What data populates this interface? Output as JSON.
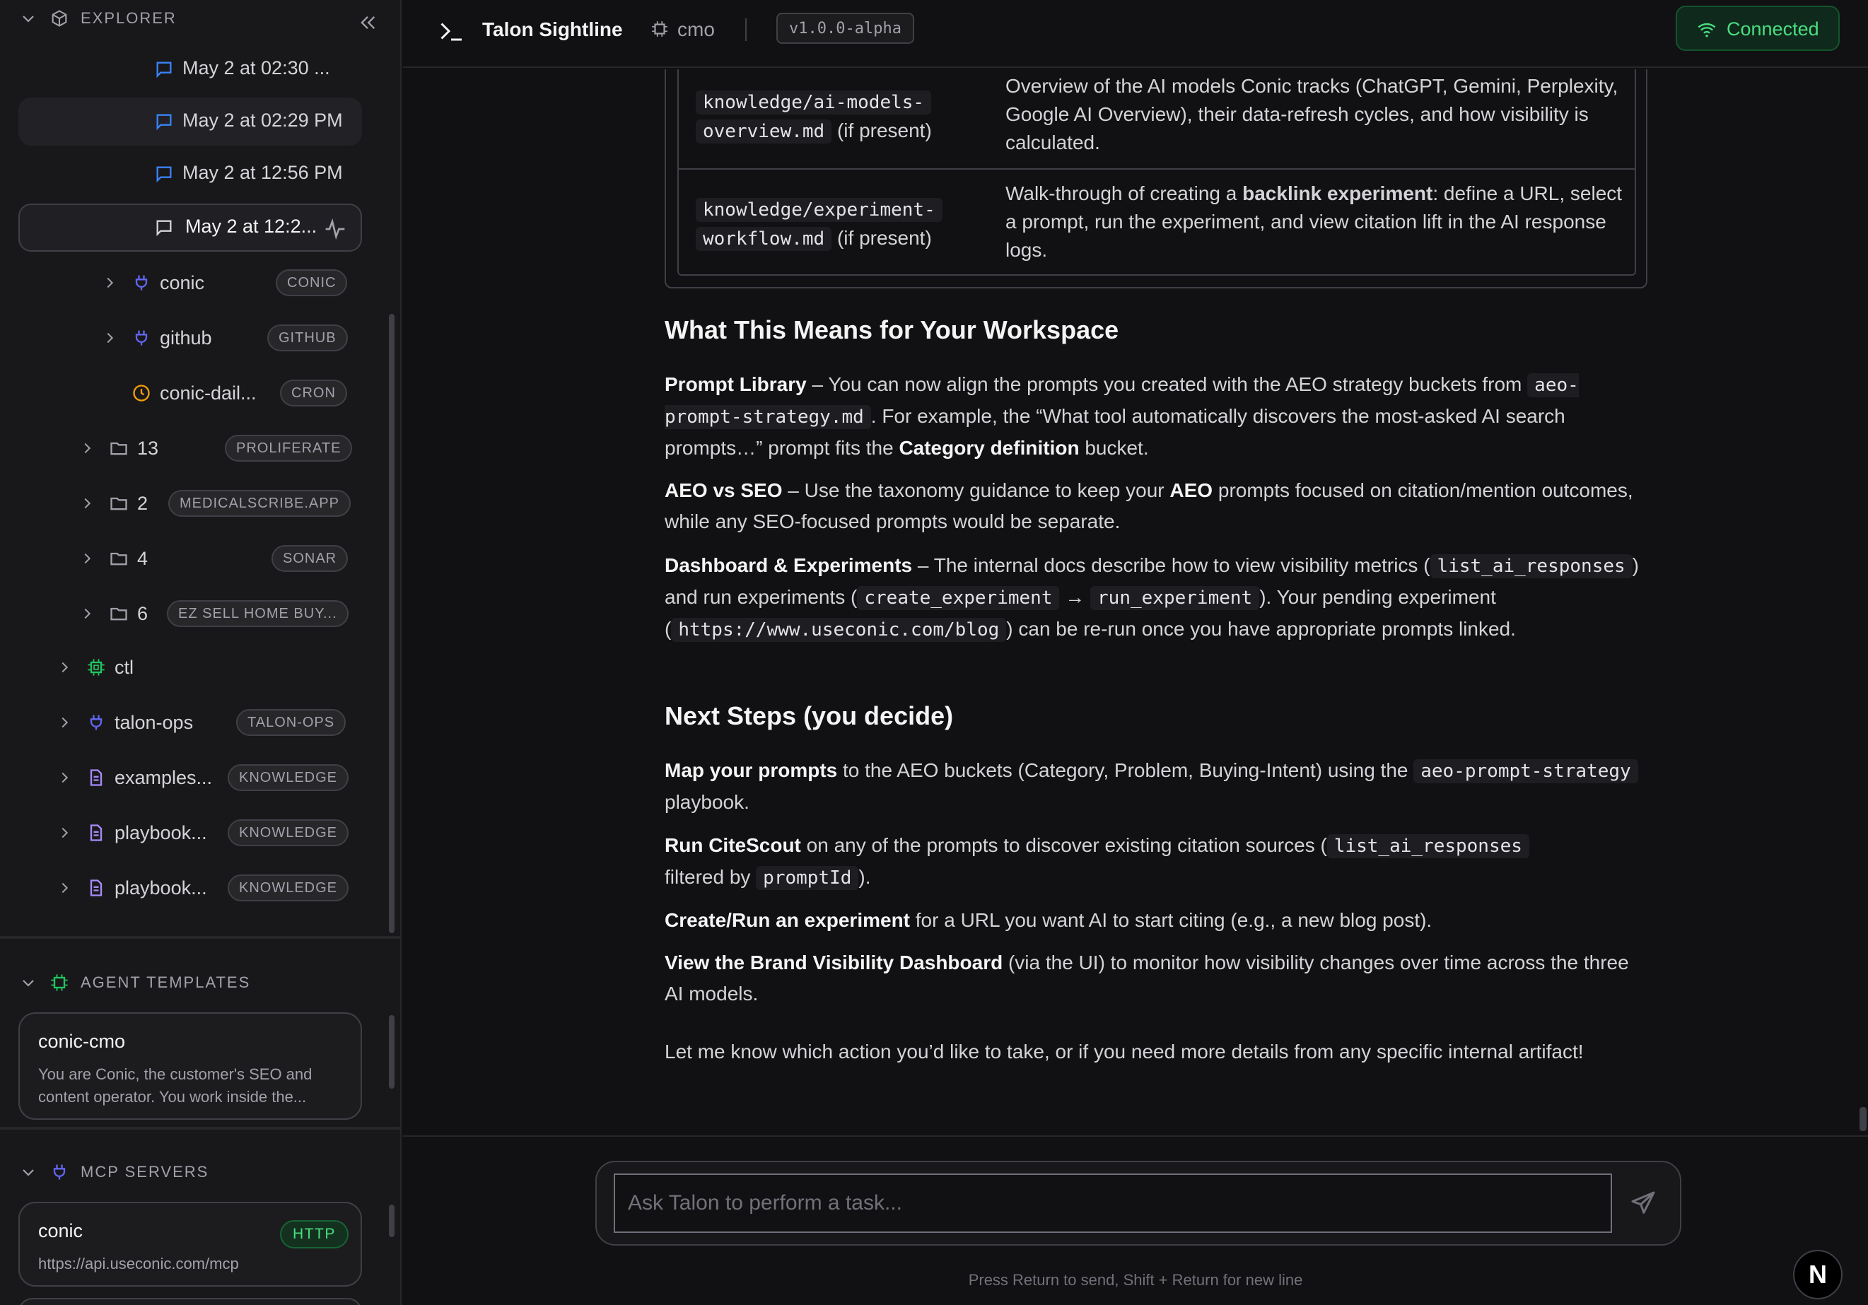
{
  "sidebar": {
    "explorer_title": "EXPLORER",
    "chats": [
      {
        "label": "May 2 at 02:30 ..."
      },
      {
        "label": "May 2 at 02:29 PM"
      },
      {
        "label": "May 2 at 12:56 PM"
      },
      {
        "label": "May 2 at 12:2..."
      }
    ],
    "tree": [
      {
        "label": "conic",
        "badge": "CONIC",
        "icon": "plug-icon"
      },
      {
        "label": "github",
        "badge": "GITHUB",
        "icon": "plug-icon"
      },
      {
        "label": "conic-dail...",
        "badge": "CRON",
        "icon": "clock-icon"
      },
      {
        "label": "13",
        "badge": "PROLIFERATE",
        "icon": "folder-icon"
      },
      {
        "label": "2",
        "badge": "MEDICALSCRIBE.APP",
        "icon": "folder-icon"
      },
      {
        "label": "4",
        "badge": "SONAR",
        "icon": "folder-icon"
      },
      {
        "label": "6",
        "badge": "EZ SELL HOME BUY...",
        "icon": "folder-icon"
      },
      {
        "label": "ctl",
        "badge": "",
        "icon": "chip-icon"
      },
      {
        "label": "talon-ops",
        "badge": "TALON-OPS",
        "icon": "plug-icon"
      },
      {
        "label": "examples...",
        "badge": "KNOWLEDGE",
        "icon": "document-icon"
      },
      {
        "label": "playbook...",
        "badge": "KNOWLEDGE",
        "icon": "document-icon"
      },
      {
        "label": "playbook...",
        "badge": "KNOWLEDGE",
        "icon": "document-icon"
      }
    ],
    "agent_templates_title": "AGENT TEMPLATES",
    "agent_template": {
      "name": "conic-cmo",
      "description": "You are Conic, the customer's SEO and content operator. You work inside the..."
    },
    "mcp_servers_title": "MCP SERVERS",
    "mcp_server": {
      "name": "conic",
      "badge": "HTTP",
      "url": "https://api.useconic.com/mcp"
    }
  },
  "header": {
    "app_title": "Talon Sightline",
    "agent_name": "cmo",
    "version": "v1.0.0-alpha",
    "status": "Connected"
  },
  "main": {
    "table_rows": [
      {
        "file_1": "knowledge/ai-models-",
        "file_2": "overview.md",
        "suffix": "(if present)",
        "desc": "Overview of the AI models Conic tracks (ChatGPT, Gemini, Perplexity, Google AI Overview), their data-refresh cycles, and how visibility is calculated."
      },
      {
        "file_1": "knowledge/experiment-",
        "file_2": "workflow.md",
        "suffix": "(if present)",
        "desc_pre": "Walk-through of creating a ",
        "desc_bold": "backlink experiment",
        "desc_post": ": define a URL, select a prompt, run the experiment, and view citation lift in the AI response logs."
      }
    ],
    "h_meaning": "What This Means for Your Workspace",
    "p1": {
      "b1": "Prompt Library",
      "t1": " – You can now align the prompts you created with the AEO strategy buckets from ",
      "c1": "aeo-prompt-strategy.md",
      "t2": ". For example, the “What tool automatically discovers the most-asked AI search prompts…” prompt fits the ",
      "b2": "Category definition",
      "t3": " bucket."
    },
    "p2": {
      "b1": "AEO vs SEO",
      "t1": " – Use the taxonomy guidance to keep your ",
      "b2": "AEO",
      "t2": " prompts focused on citation/mention outcomes, while any SEO-focused prompts would be separate."
    },
    "p3": {
      "b1": "Dashboard & Experiments",
      "t1": " – The internal docs describe how to view visibility metrics (",
      "c1": "list_ai_responses",
      "t2": ") and run experiments (",
      "c2": "create_experiment",
      "arrow": " → ",
      "c3": "run_experiment",
      "t3": "). Your pending experiment (",
      "c4": "https://www.useconic.com/blog",
      "t4": ") can be re-run once you have appropriate prompts linked."
    },
    "h_next": "Next Steps (you decide)",
    "s1": {
      "b": "Map your prompts",
      "t1": " to the AEO buckets (Category, Problem, Buying-Intent) using the ",
      "c": "aeo-prompt-strategy",
      "t2": " playbook."
    },
    "s2": {
      "b": "Run CiteScout",
      "t1": " on any of the prompts to discover existing citation sources (",
      "c1": "list_ai_responses",
      "t2": " filtered by ",
      "c2": "promptId",
      "t3": ")."
    },
    "s3": {
      "b": "Create/Run an experiment",
      "t1": " for a URL you want AI to start citing (e.g., a new blog post)."
    },
    "s4": {
      "b": "View the Brand Visibility Dashboard",
      "t1": " (via the UI) to monitor how visibility changes over time across the three AI models."
    },
    "closing": "Let me know which action you’d like to take, or if you need more details from any specific internal artifact!"
  },
  "composer": {
    "placeholder": "Ask Talon to perform a task...",
    "hint": "Press Return to send, Shift + Return for new line",
    "n_button": "N"
  },
  "colors": {
    "plug": "#6366f1",
    "clock": "#f59e0b",
    "chip": "#22c55e",
    "doc": "#a78bfa",
    "connected": "#4ade80"
  }
}
